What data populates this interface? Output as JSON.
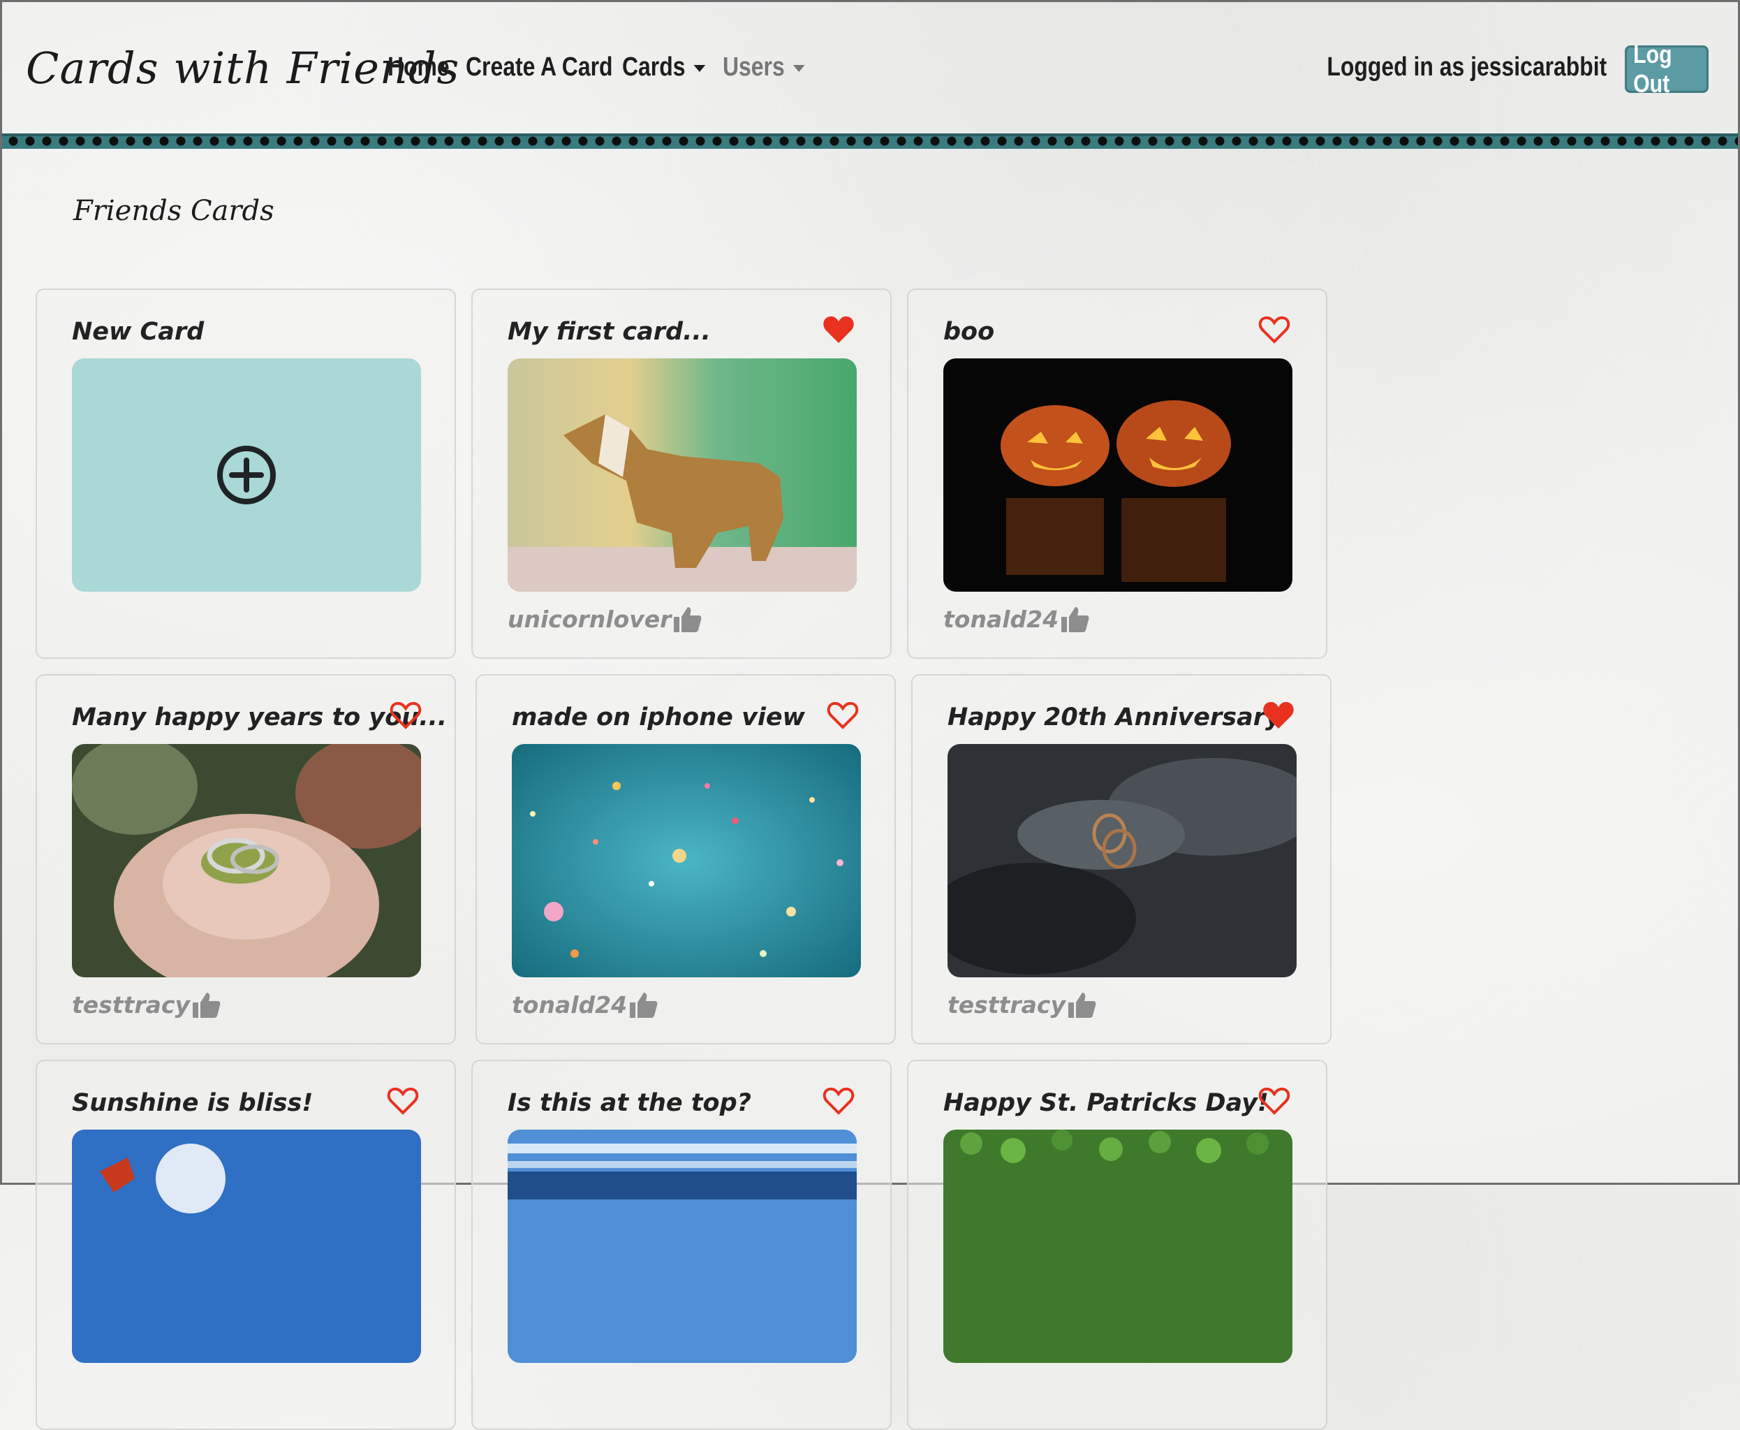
{
  "nav": {
    "brand": "Cards with Friends",
    "home": "Home",
    "create": "Create A Card",
    "cards": "Cards",
    "users": "Users",
    "logged_in": "Logged in as jessicarabbit",
    "logout": "Log Out"
  },
  "section_title": "Friends Cards",
  "new_card": {
    "title": "New Card",
    "icon": "plus-circle-icon"
  },
  "cards": [
    {
      "title": "My first card...",
      "author": "unicornlover",
      "favorited": true,
      "image": "wooden-unicorn"
    },
    {
      "title": "boo",
      "author": "tonald24",
      "favorited": false,
      "image": "jack-o-lanterns"
    },
    {
      "title": "Many happy years to you...",
      "author": "testtracy",
      "favorited": false,
      "image": "rings-on-flower"
    },
    {
      "title": "made on iphone view",
      "author": "tonald24",
      "favorited": false,
      "image": "confetti"
    },
    {
      "title": "Happy 20th Anniversary",
      "author": "testtracy",
      "favorited": true,
      "image": "rings-on-water"
    },
    {
      "title": "Sunshine is bliss!",
      "author": "",
      "favorited": false,
      "image": "sunshine"
    },
    {
      "title": "Is this at the top?",
      "author": "",
      "favorited": false,
      "image": "building-blur"
    },
    {
      "title": "Happy St. Patricks Day!",
      "author": "",
      "favorited": false,
      "image": "clovers"
    }
  ],
  "colors": {
    "heart": "#e8321f",
    "accent": "#5c9ba3",
    "new_card_bg": "#a9d8d6",
    "author": "#8d8d8d"
  }
}
